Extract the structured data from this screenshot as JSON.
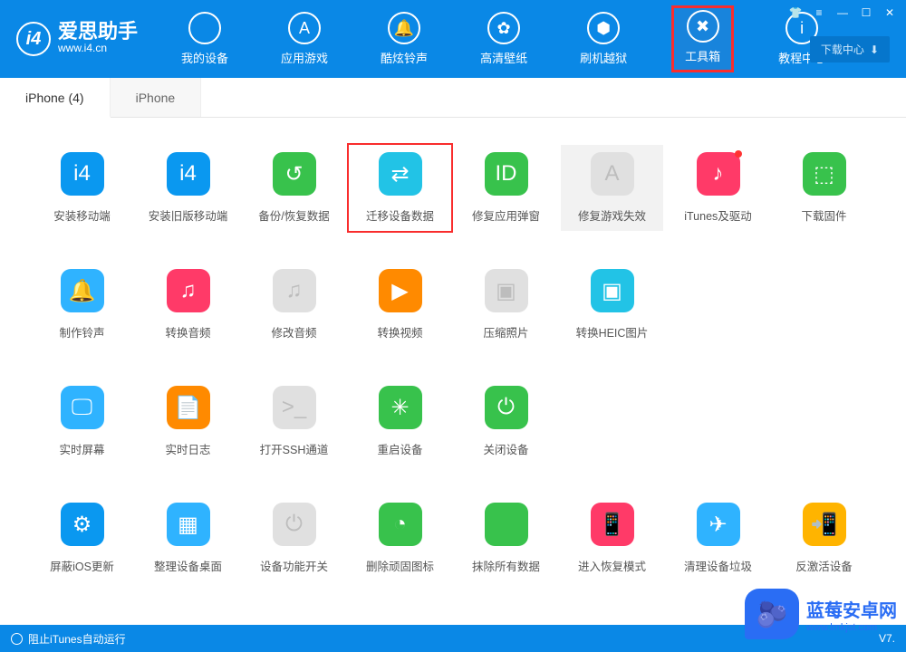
{
  "app": {
    "name_cn": "爱思助手",
    "name_en": "www.i4.cn",
    "version": "V7."
  },
  "title_icons": {
    "tshirt": "👕",
    "menu": "≡",
    "min": "—",
    "max": "☐",
    "close": "✕"
  },
  "download_center": "下载中心",
  "nav": [
    {
      "key": "device",
      "label": "我的设备",
      "glyph": ""
    },
    {
      "key": "apps",
      "label": "应用游戏",
      "glyph": "A"
    },
    {
      "key": "ring",
      "label": "酷炫铃声",
      "glyph": "🔔"
    },
    {
      "key": "wall",
      "label": "高清壁纸",
      "glyph": "✿"
    },
    {
      "key": "flash",
      "label": "刷机越狱",
      "glyph": "⬢"
    },
    {
      "key": "toolbox",
      "label": "工具箱",
      "glyph": "✖",
      "highlight": true
    },
    {
      "key": "help",
      "label": "教程中心",
      "glyph": "i"
    }
  ],
  "tabs": [
    {
      "key": "iphone4",
      "label": "iPhone (4)",
      "active": true
    },
    {
      "key": "iphone",
      "label": "iPhone"
    }
  ],
  "tools": [
    {
      "name": "install-mobile",
      "label": "安装移动端",
      "color": "c-blue",
      "glyph": "i4"
    },
    {
      "name": "install-old-mobile",
      "label": "安装旧版移动端",
      "color": "c-blue",
      "glyph": "i4"
    },
    {
      "name": "backup-restore",
      "label": "备份/恢复数据",
      "color": "c-green",
      "glyph": "↺"
    },
    {
      "name": "migrate-data",
      "label": "迁移设备数据",
      "color": "c-cyan",
      "glyph": "⇄",
      "highlight": true
    },
    {
      "name": "fix-popup",
      "label": "修复应用弹窗",
      "color": "c-green",
      "glyph": "ID"
    },
    {
      "name": "fix-game",
      "label": "修复游戏失效",
      "color": "c-gray",
      "glyph": "A",
      "hover": true
    },
    {
      "name": "itunes-driver",
      "label": "iTunes及驱动",
      "color": "c-pink",
      "glyph": "♪",
      "badge": true
    },
    {
      "name": "download-fw",
      "label": "下载固件",
      "color": "c-green",
      "glyph": "⬚"
    },
    {
      "name": "make-ringtone",
      "label": "制作铃声",
      "color": "c-blue-l",
      "glyph": "🔔"
    },
    {
      "name": "convert-audio",
      "label": "转换音频",
      "color": "c-pink",
      "glyph": "♫"
    },
    {
      "name": "modify-audio",
      "label": "修改音频",
      "color": "c-gray",
      "glyph": "♫"
    },
    {
      "name": "convert-video",
      "label": "转换视频",
      "color": "c-orange",
      "glyph": "▶"
    },
    {
      "name": "compress-photo",
      "label": "压缩照片",
      "color": "c-gray",
      "glyph": "▣"
    },
    {
      "name": "convert-heic",
      "label": "转换HEIC图片",
      "color": "c-cyan",
      "glyph": "▣"
    },
    {
      "name": "realtime-screen",
      "label": "实时屏幕",
      "color": "c-blue-l",
      "glyph": "🖵"
    },
    {
      "name": "realtime-log",
      "label": "实时日志",
      "color": "c-orange",
      "glyph": "📄"
    },
    {
      "name": "open-ssh",
      "label": "打开SSH通道",
      "color": "c-gray",
      "glyph": ">_"
    },
    {
      "name": "reboot-device",
      "label": "重启设备",
      "color": "c-green",
      "glyph": "✳"
    },
    {
      "name": "shutdown-device",
      "label": "关闭设备",
      "color": "c-green",
      "glyph": "⏻"
    },
    {
      "name": "block-ios-update",
      "label": "屏蔽iOS更新",
      "color": "c-blue",
      "glyph": "⚙"
    },
    {
      "name": "organize-desktop",
      "label": "整理设备桌面",
      "color": "c-blue-l",
      "glyph": "▦"
    },
    {
      "name": "feature-toggle",
      "label": "设备功能开关",
      "color": "c-gray",
      "glyph": "⏻"
    },
    {
      "name": "del-stubborn-icon",
      "label": "删除顽固图标",
      "color": "c-green",
      "glyph": "◔"
    },
    {
      "name": "erase-all",
      "label": "抹除所有数据",
      "color": "c-green",
      "glyph": ""
    },
    {
      "name": "recovery-mode",
      "label": "进入恢复模式",
      "color": "c-pink",
      "glyph": "📱"
    },
    {
      "name": "clean-garbage",
      "label": "清理设备垃圾",
      "color": "c-blue-l",
      "glyph": "✈"
    },
    {
      "name": "deactivate",
      "label": "反激活设备",
      "color": "c-yellow",
      "glyph": "📲"
    }
  ],
  "footer": {
    "block_itunes": "阻止iTunes自动运行"
  },
  "watermark": {
    "cn": "蓝莓安卓网",
    "en": "www.lmkjst.com",
    "emoji": "🫐"
  }
}
